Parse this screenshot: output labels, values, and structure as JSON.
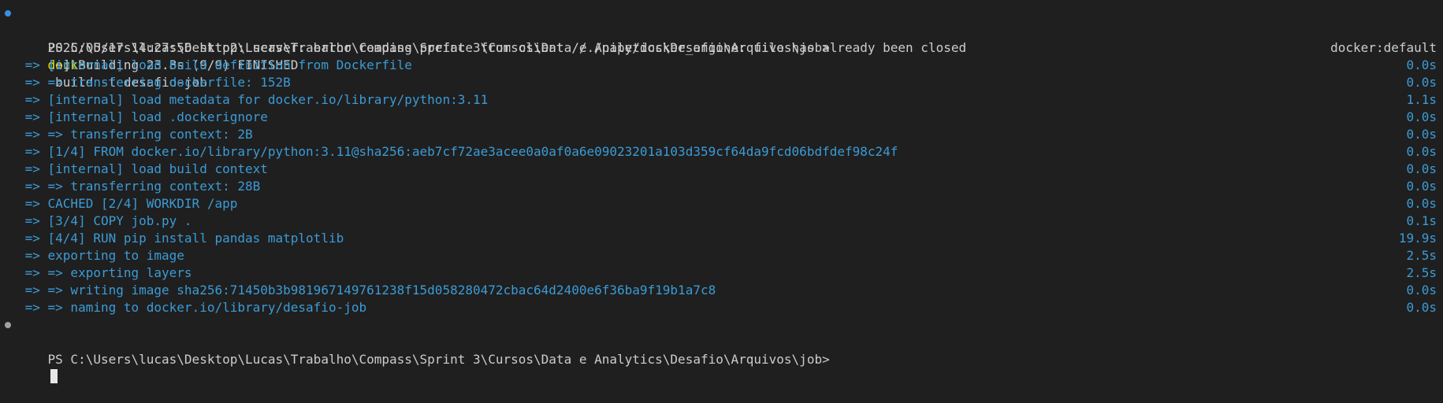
{
  "terminal": {
    "prompt": "PS C:\\Users\\lucas\\Desktop\\Lucas\\Trabalho\\Compass\\Sprint 3\\Cursos\\Data e Analytics\\Desafio\\Arquivos\\job>",
    "command_keyword": "docker",
    "command_args": " build -t desafio-job .",
    "error_line": "2025/05/17 14:27:56 http2: server: error reading preface from client //./pipe/docker_engine: file has already been closed",
    "status_line": "[+] Building 23.8s (9/9) FINISHED",
    "builder": "docker:default",
    "steps": [
      {
        "text": " => [internal] load build definition from Dockerfile",
        "time": "0.0s"
      },
      {
        "text": " => => transferring dockerfile: 152B",
        "time": "0.0s"
      },
      {
        "text": " => [internal] load metadata for docker.io/library/python:3.11",
        "time": "1.1s"
      },
      {
        "text": " => [internal] load .dockerignore",
        "time": "0.0s"
      },
      {
        "text": " => => transferring context: 2B",
        "time": "0.0s"
      },
      {
        "text": " => [1/4] FROM docker.io/library/python:3.11@sha256:aeb7cf72ae3acee0a0af0a6e09023201a103d359cf64da9fcd06bdfdef98c24f",
        "time": "0.0s"
      },
      {
        "text": " => [internal] load build context",
        "time": "0.0s"
      },
      {
        "text": " => => transferring context: 28B",
        "time": "0.0s"
      },
      {
        "text": " => CACHED [2/4] WORKDIR /app",
        "time": "0.0s"
      },
      {
        "text": " => [3/4] COPY job.py .",
        "time": "0.1s"
      },
      {
        "text": " => [4/4] RUN pip install pandas matplotlib",
        "time": "19.9s"
      },
      {
        "text": " => exporting to image",
        "time": "2.5s"
      },
      {
        "text": " => => exporting layers",
        "time": "2.5s"
      },
      {
        "text": " => => writing image sha256:71450b3b981967149761238f15d058280472cbac64d2400e6f36ba9f19b1a7c8",
        "time": "0.0s"
      },
      {
        "text": " => => naming to docker.io/library/desafio-job",
        "time": "0.0s"
      }
    ],
    "final_prompt": "PS C:\\Users\\lucas\\Desktop\\Lucas\\Trabalho\\Compass\\Sprint 3\\Cursos\\Data e Analytics\\Desafio\\Arquivos\\job>"
  },
  "colors": {
    "background": "#1f1f1f",
    "text": "#cccccc",
    "command_keyword": "#e5e510",
    "step_text": "#3b9bd6",
    "success_dot": "#3a8ee6",
    "idle_dot": "#a0a0a0"
  }
}
